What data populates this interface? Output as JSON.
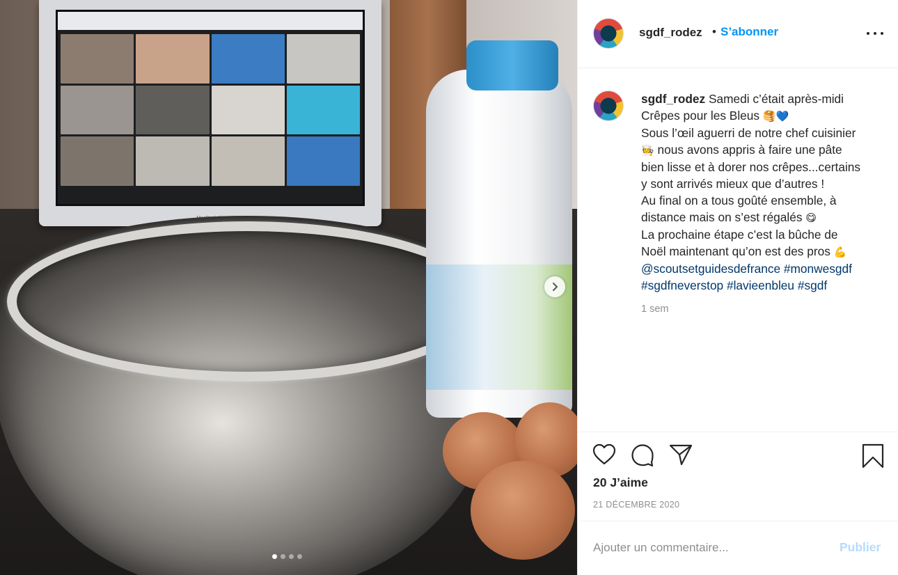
{
  "post": {
    "username": "sgdf_rodez",
    "dot": "•",
    "follow_label": "S’abonner",
    "more_icon": "more-options-icon"
  },
  "photo": {
    "laptop_brand": "MacBook Air",
    "carousel": {
      "count": 4,
      "active_index": 0
    }
  },
  "caption": {
    "username": "sgdf_rodez",
    "lines": [
      "Samedi c’était après-midi",
      "Crêpes pour les Bleus",
      "Sous l’œil aguerri de notre chef cuisinier",
      "nous avons appris à faire une pâte",
      "bien lisse et à dorer nos crêpes...certains",
      "y sont arrivés mieux que d’autres !",
      "Au final on a tous goûté ensemble, à",
      "distance mais on s’est régalés",
      "La prochaine étape c’est la bûche de",
      "Noël maintenant qu’on est des pros"
    ],
    "emojis": {
      "pancakes": "🥞",
      "blue_heart": "💙",
      "chef": "🧑‍🍳",
      "yum": "😋",
      "muscle": "💪"
    },
    "hashtags_line1": [
      "@scoutsetguidesdefrance",
      "#monwesgdf"
    ],
    "hashtags_line2": [
      "#sgdfneverstop",
      "#lavieenbleu",
      "#sgdf"
    ],
    "time_ago": "1 sem"
  },
  "actions": {
    "likes": "20 J’aime",
    "date": "21 DÉCEMBRE 2020"
  },
  "comment": {
    "placeholder": "Ajouter un commentaire...",
    "publish_label": "Publier"
  },
  "colors": {
    "accent": "#0095f6",
    "link": "#00376b",
    "publish_disabled": "#b3dbff",
    "muted": "#8e8e8e"
  }
}
